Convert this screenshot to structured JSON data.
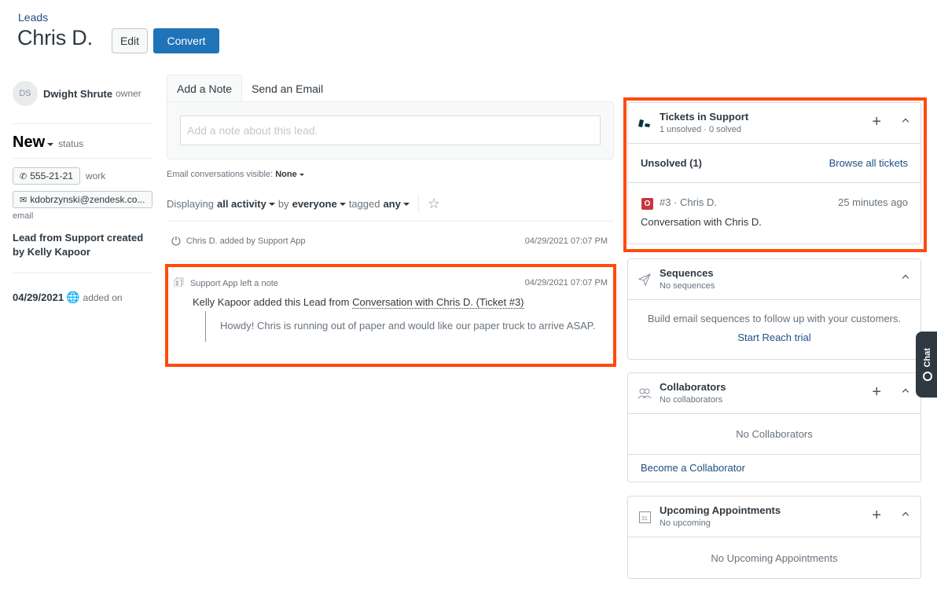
{
  "header": {
    "breadcrumb": "Leads",
    "title": "Chris D.",
    "edit_label": "Edit",
    "convert_label": "Convert"
  },
  "sidebar": {
    "owner": {
      "initials": "DS",
      "name": "Dwight Shrute",
      "label": "owner"
    },
    "status": {
      "value": "New",
      "label": "status"
    },
    "phone": {
      "icon": "phone-icon",
      "value": "555-21-21",
      "label": "work"
    },
    "email": {
      "icon": "mail-icon",
      "value": "kdobrzynski@zendesk.co...",
      "label": "email"
    },
    "lead_source": "Lead from Support created by Kelly Kapoor",
    "added": {
      "date": "04/29/2021",
      "icon": "globe-icon",
      "label": "added on"
    }
  },
  "composer": {
    "tabs": [
      {
        "label": "Add a Note",
        "active": true
      },
      {
        "label": "Send an Email",
        "active": false
      }
    ],
    "note_placeholder": "Add a note about this lead."
  },
  "email_visibility": {
    "label": "Email conversations visible:",
    "value": "None"
  },
  "activity_filter": {
    "prefix": "Displaying",
    "activity": "all activity",
    "by_word": "by",
    "who": "everyone",
    "tagged_word": "tagged",
    "tag": "any"
  },
  "activities": [
    {
      "icon": "power-icon",
      "text": "Chris D. added by Support App",
      "time": "04/29/2021 07:07 PM"
    },
    {
      "icon": "note-icon",
      "text": "Support App left a note",
      "time": "04/29/2021 07:07 PM",
      "body_prefix": "Kelly Kapoor added this Lead from",
      "body_link": "Conversation with Chris D. (Ticket #3)",
      "quote": "Howdy! Chris is running out of paper and would like our paper truck to arrive ASAP."
    }
  ],
  "tickets": {
    "title": "Tickets in Support",
    "subtitle": "1 unsolved · 0 solved",
    "unsolved_label": "Unsolved (1)",
    "browse_label": "Browse all tickets",
    "items": [
      {
        "status_letter": "O",
        "status_color": "#cc3340",
        "id": "#3 · Chris D.",
        "ago": "25 minutes ago",
        "subject": "Conversation with Chris D."
      }
    ]
  },
  "sequences": {
    "title": "Sequences",
    "subtitle": "No sequences",
    "body": "Build email sequences to follow up with your customers.",
    "link": "Start Reach trial"
  },
  "collaborators": {
    "title": "Collaborators",
    "subtitle": "No collaborators",
    "empty": "No Collaborators",
    "link": "Become a Collaborator"
  },
  "appointments": {
    "title": "Upcoming Appointments",
    "subtitle": "No upcoming",
    "calendar_day": "31",
    "empty": "No Upcoming Appointments"
  },
  "chat": {
    "label": "Chat"
  },
  "colors": {
    "accent": "#1f73b7",
    "link": "#1f4f7f",
    "highlight": "#ff4a0c"
  }
}
